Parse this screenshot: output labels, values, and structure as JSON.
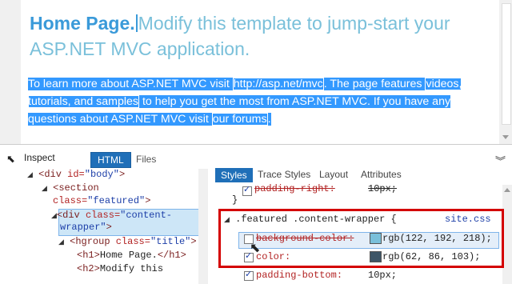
{
  "preview": {
    "heading_bold": "Home Page.",
    "heading_rest": "Modify this template to jump-start your ASP.NET MVC application.",
    "para_1": "To learn more about ASP.NET MVC visit ",
    "link_1": "http://asp.net/mvc",
    "para_2": ". The page features ",
    "link_2": "videos, tutorials, and samples",
    "para_3": " to help you get the most from ASP.NET MVC. If you have any questions about ASP.NET MVC visit ",
    "link_3": "our forums",
    "para_4": "."
  },
  "devtools": {
    "inspect_label": "Inspect",
    "tab_html": "HTML",
    "tab_files": "Files",
    "dom": {
      "l1_tag": "<div ",
      "l1_attr": "id=",
      "l1_val": "\"body\"",
      "l1_close": ">",
      "l2_tag": "<section",
      "l3_attr": "class=",
      "l3_val": "\"featured\"",
      "l3_close": ">",
      "l4_tag": "<div ",
      "l4_attr": "class=",
      "l4_val": "\"content-",
      "l5_val": "wrapper\"",
      "l5_close": ">",
      "l6_tag": "<hgroup ",
      "l6_attr": "class=",
      "l6_val": "\"title\"",
      "l6_close": ">",
      "l7_open": "<h1>",
      "l7_text": "Home Page.",
      "l7_close": "</h1>",
      "l8_open": "<h2>",
      "l8_text": "Modify this"
    },
    "styles_tabs": [
      "Styles",
      "Trace Styles",
      "Layout",
      "Attributes"
    ],
    "rules": {
      "prev_prop": "padding-right:",
      "prev_val": "10px;",
      "prev_close": "}",
      "selector": ".featured .content-wrapper {",
      "source": "site.css",
      "bg_prop": "background-color:",
      "bg_val": "rgb(122, 192, 218);",
      "color_prop": "color:",
      "color_val": "rgb(62, 86, 103);",
      "pb_prop": "padding-bottom:",
      "pb_val": "10px;"
    },
    "colors": {
      "bg_swatch": "#7ac0da",
      "color_swatch": "#3e5667"
    }
  }
}
